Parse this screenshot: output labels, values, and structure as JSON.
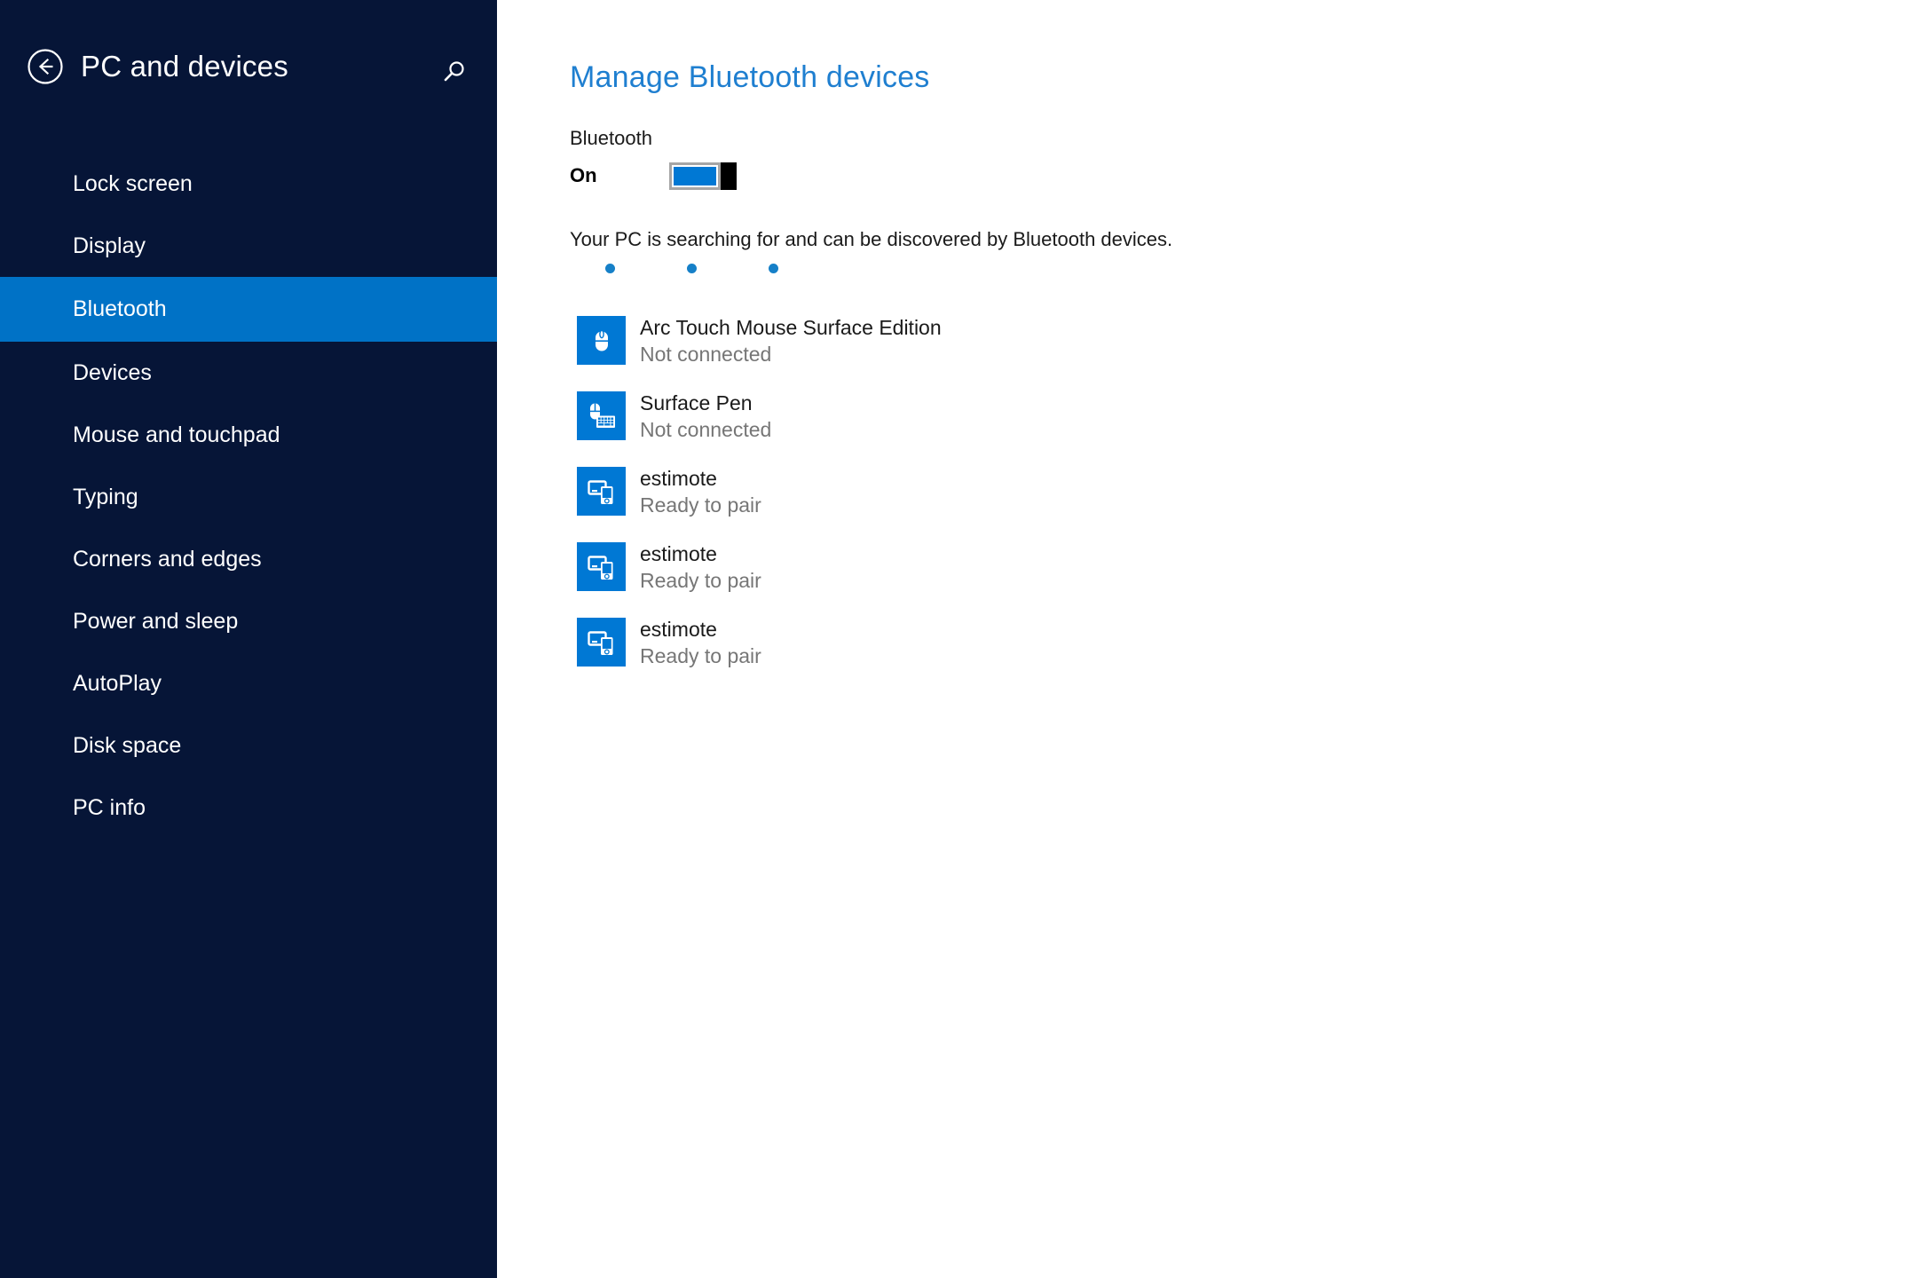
{
  "sidebar": {
    "back_icon": "back-arrow-circle-icon",
    "title": "PC and devices",
    "search_icon": "search-icon",
    "items": [
      {
        "label": "Lock screen",
        "selected": false
      },
      {
        "label": "Display",
        "selected": false
      },
      {
        "label": "Bluetooth",
        "selected": true
      },
      {
        "label": "Devices",
        "selected": false
      },
      {
        "label": "Mouse and touchpad",
        "selected": false
      },
      {
        "label": "Typing",
        "selected": false
      },
      {
        "label": "Corners and edges",
        "selected": false
      },
      {
        "label": "Power and sleep",
        "selected": false
      },
      {
        "label": "AutoPlay",
        "selected": false
      },
      {
        "label": "Disk space",
        "selected": false
      },
      {
        "label": "PC info",
        "selected": false
      }
    ]
  },
  "main": {
    "title": "Manage Bluetooth devices",
    "bluetooth_label": "Bluetooth",
    "toggle_state": "On",
    "toggle_on": true,
    "searching_text": "Your PC is searching for and can be discovered by Bluetooth devices.",
    "progress_dots": 3,
    "devices": [
      {
        "icon": "mouse-icon",
        "name": "Arc Touch Mouse Surface Edition",
        "status": "Not connected"
      },
      {
        "icon": "mouse-keyboard-icon",
        "name": "Surface Pen",
        "status": "Not connected"
      },
      {
        "icon": "monitor-phone-icon",
        "name": "estimote",
        "status": "Ready to pair"
      },
      {
        "icon": "monitor-phone-icon",
        "name": "estimote",
        "status": "Ready to pair"
      },
      {
        "icon": "monitor-phone-icon",
        "name": "estimote",
        "status": "Ready to pair"
      }
    ]
  },
  "colors": {
    "sidebar_bg": "#061537",
    "accent": "#0078d4",
    "selected_nav": "#0072c6",
    "title_blue": "#1f7fd0",
    "status_gray": "#767676"
  }
}
